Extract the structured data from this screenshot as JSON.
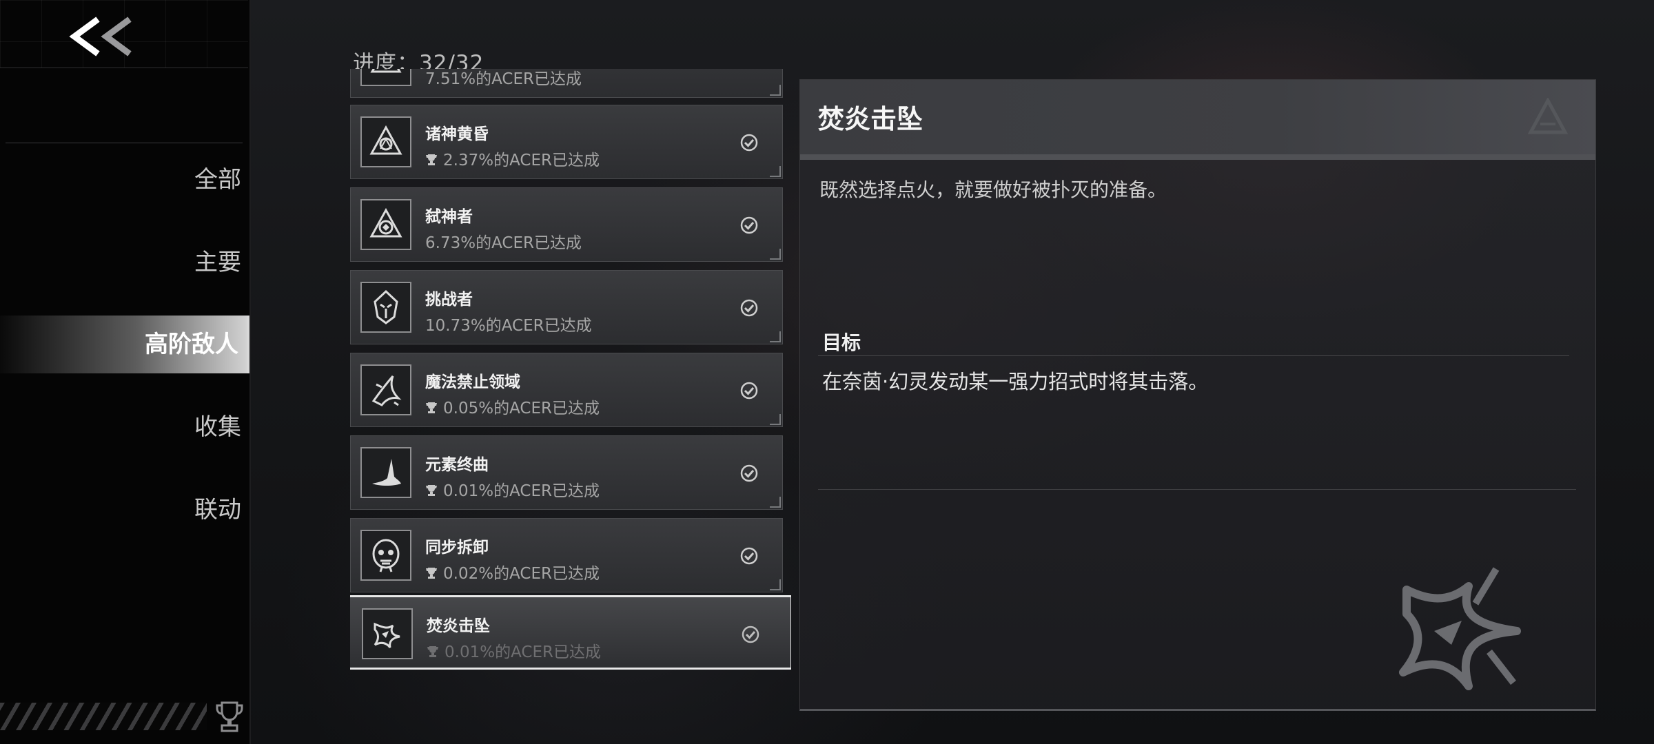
{
  "nav": {
    "back_label": "<<",
    "items": [
      {
        "label": "全部"
      },
      {
        "label": "主要"
      },
      {
        "label": "高阶敌人"
      },
      {
        "label": "收集"
      },
      {
        "label": "联动"
      }
    ],
    "active_index": 2
  },
  "progress": {
    "text": "进度：32/32"
  },
  "achievements": [
    {
      "title": "",
      "rate": "7.51%的ACER已达成",
      "trophy": false,
      "completed": true
    },
    {
      "title": "诸神黄昏",
      "rate": "2.37%的ACER已达成",
      "trophy": true,
      "completed": true
    },
    {
      "title": "弑神者",
      "rate": "6.73%的ACER已达成",
      "trophy": false,
      "completed": true
    },
    {
      "title": "挑战者",
      "rate": "10.73%的ACER已达成",
      "trophy": false,
      "completed": true
    },
    {
      "title": "魔法禁止领域",
      "rate": "0.05%的ACER已达成",
      "trophy": true,
      "completed": true
    },
    {
      "title": "元素终曲",
      "rate": "0.01%的ACER已达成",
      "trophy": true,
      "completed": true
    },
    {
      "title": "同步拆卸",
      "rate": "0.02%的ACER已达成",
      "trophy": true,
      "completed": true
    },
    {
      "title": "焚炎击坠",
      "rate": "0.01%的ACER已达成",
      "trophy": true,
      "completed": true,
      "selected": true
    }
  ],
  "detail": {
    "title": "焚炎击坠",
    "description": "既然选择点火，就要做好被扑灭的准备。",
    "goal_label": "目标",
    "goal_text": "在奈茵·幻灵发动某一强力招式时将其击落。"
  },
  "colors": {
    "sidebar_bg": "#050505",
    "active_highlight": "#d8d8d8",
    "card_bg": "#333437",
    "selected_border": "#e9e9e9",
    "text_primary": "#f2f2f2",
    "text_secondary": "#a6a6a6"
  }
}
